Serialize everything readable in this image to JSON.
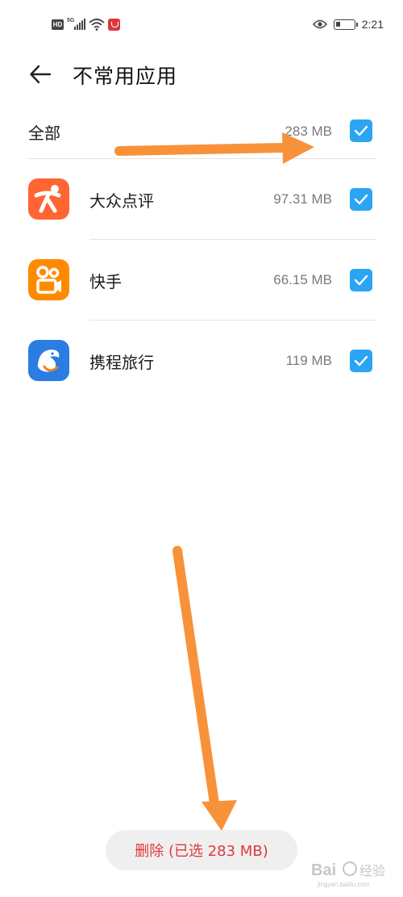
{
  "status_bar": {
    "left_icons": [
      "hd-icon",
      "signal-5g-icon",
      "wifi-icon",
      "notification-app-icon"
    ],
    "network_label": "5G",
    "hd_label": "HD",
    "right_icons": [
      "eye-icon",
      "battery-icon"
    ],
    "time": "2:21"
  },
  "header": {
    "title": "不常用应用",
    "back_icon": "back-arrow-icon"
  },
  "select_all": {
    "label": "全部",
    "size": "283 MB",
    "checked": true
  },
  "apps": [
    {
      "name": "大众点评",
      "size": "97.31 MB",
      "checked": true,
      "icon": "dianping-app-icon",
      "icon_color": "#ff6633"
    },
    {
      "name": "快手",
      "size": "66.15 MB",
      "checked": true,
      "icon": "kuaishou-app-icon",
      "icon_color": "#ff8a00"
    },
    {
      "name": "携程旅行",
      "size": "119 MB",
      "checked": true,
      "icon": "ctrip-app-icon",
      "icon_color": "#2a7de1"
    }
  ],
  "delete_button": {
    "label": "删除 (已选 283 MB)"
  },
  "annotation_arrows": {
    "color": "#f8923a",
    "count": 2
  },
  "watermark": {
    "text": "jingyan.baidu.com"
  },
  "colors": {
    "checkbox": "#2ba5f3",
    "delete_text": "#e0373a",
    "size_text": "#7a7a7a"
  }
}
